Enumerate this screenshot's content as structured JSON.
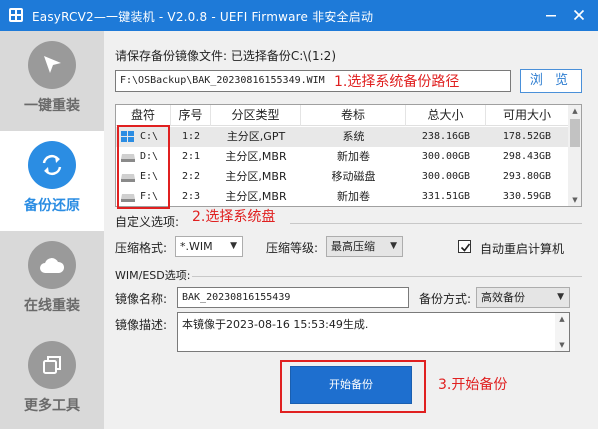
{
  "window": {
    "title": "EasyRCV2—一键装机 - V2.0.8 - UEFI Firmware 非安全启动",
    "minimize_icon": "minimize-icon",
    "close_icon": "close-icon"
  },
  "sidebar": {
    "items": [
      {
        "label": "一键重装",
        "icon": "cursor-arrow-icon",
        "active": false
      },
      {
        "label": "备份还原",
        "icon": "refresh-arrows-icon",
        "active": true
      },
      {
        "label": "在线重装",
        "icon": "cloud-icon",
        "active": false
      },
      {
        "label": "更多工具",
        "icon": "copy-squares-icon",
        "active": false
      }
    ]
  },
  "backup": {
    "save_label": "请保存备份镜像文件: 已选择备份C:\\(1:2)",
    "path_value": "F:\\OSBackup\\BAK_20230816155349.WIM",
    "annotation_1": "1.选择系统备份路径",
    "browse_label": "浏 览",
    "annotation_2": "2.选择系统盘",
    "annotation_3": "3.开始备份"
  },
  "partition_table": {
    "headers": [
      "盘符",
      "序号",
      "分区类型",
      "卷标",
      "总大小",
      "可用大小"
    ],
    "rows": [
      {
        "drive": "C:\\",
        "index": "1:2",
        "type": "主分区,GPT",
        "label": "系统",
        "total": "238.16GB",
        "free": "178.52GB",
        "selected": true,
        "icon": "windows-drive-icon"
      },
      {
        "drive": "D:\\",
        "index": "2:1",
        "type": "主分区,MBR",
        "label": "新加卷",
        "total": "300.00GB",
        "free": "298.43GB",
        "selected": false,
        "icon": "drive-icon"
      },
      {
        "drive": "E:\\",
        "index": "2:2",
        "type": "主分区,MBR",
        "label": "移动磁盘",
        "total": "300.00GB",
        "free": "293.80GB",
        "selected": false,
        "icon": "drive-icon"
      },
      {
        "drive": "F:\\",
        "index": "2:3",
        "type": "主分区,MBR",
        "label": "新加卷",
        "total": "331.51GB",
        "free": "330.59GB",
        "selected": false,
        "icon": "drive-icon"
      }
    ]
  },
  "custom_options": {
    "section_label": "自定义选项:",
    "compress_format_label": "压缩格式:",
    "compress_format_value": "*.WIM",
    "compress_level_label": "压缩等级:",
    "compress_level_value": "最高压缩",
    "auto_restart_label": "自动重启计算机",
    "auto_restart_checked": true
  },
  "wim_options": {
    "section_label": "WIM/ESD选项:",
    "image_name_label": "镜像名称:",
    "image_name_value": "BAK_20230816155439",
    "backup_mode_label": "备份方式:",
    "backup_mode_value": "高效备份",
    "image_desc_label": "镜像描述:",
    "image_desc_value": "本镜像于2023-08-16 15:53:49生成."
  },
  "actions": {
    "start_label": "开始备份"
  },
  "colors": {
    "titlebar": "#1e7ad8",
    "accent": "#2b8de3",
    "annotation_red": "#e02020",
    "button": "#1e6fcf"
  }
}
